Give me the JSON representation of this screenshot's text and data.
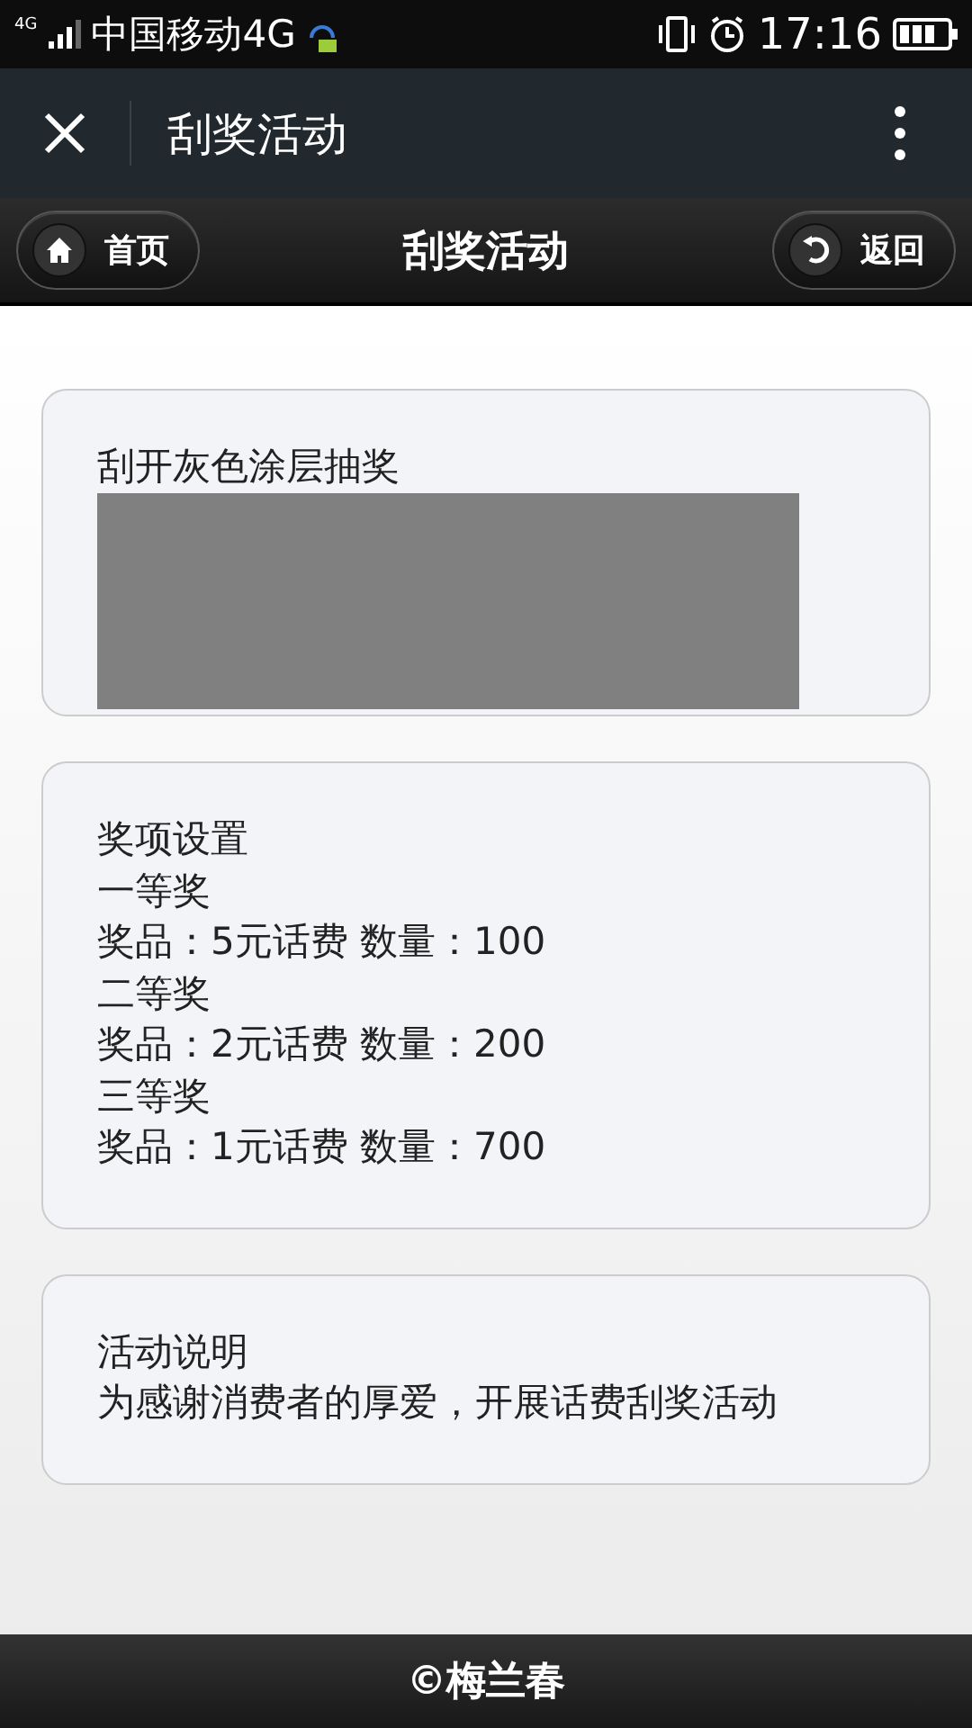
{
  "status_bar": {
    "carrier": "中国移动4G",
    "network": "4G",
    "time": "17:16"
  },
  "app_header": {
    "title": "刮奖活动"
  },
  "nav_bar": {
    "home_label": "首页",
    "title": "刮奖活动",
    "back_label": "返回"
  },
  "scratch_card": {
    "title": "刮开灰色涂层抽奖"
  },
  "prize_card": {
    "title": "奖项设置",
    "prizes": [
      {
        "name": "一等奖",
        "detail": "奖品：5元话费 数量：100"
      },
      {
        "name": "二等奖",
        "detail": "奖品：2元话费 数量：200"
      },
      {
        "name": "三等奖",
        "detail": "奖品：1元话费 数量：700"
      }
    ]
  },
  "info_card": {
    "title": "活动说明",
    "text": "为感谢消费者的厚爱，开展话费刮奖活动"
  },
  "footer": {
    "text": "©梅兰春"
  }
}
